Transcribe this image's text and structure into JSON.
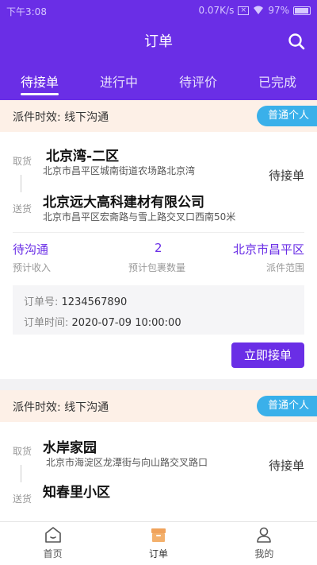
{
  "statusbar": {
    "time": "下午3:08",
    "network": "0.07K/s",
    "battery": "97%"
  },
  "header": {
    "title": "订单"
  },
  "tabs": [
    {
      "label": "待接单",
      "active": true
    },
    {
      "label": "进行中",
      "active": false
    },
    {
      "label": "待评价",
      "active": false
    },
    {
      "label": "已完成",
      "active": false
    }
  ],
  "orders": [
    {
      "dispatch_label": "派件时效: 线下沟通",
      "badge": "普通个人",
      "pickup_side": "取货",
      "deliver_side": "送货",
      "pickup_name": "北京湾-二区",
      "pickup_addr": "北京市昌平区城南街道农场路北京湾",
      "deliver_name": "北京远大高科建材有限公司",
      "deliver_addr": "北京市昌平区宏斋路与雪上路交叉口西南50米",
      "status": "待接单",
      "income_value": "待沟通",
      "income_label": "预计收入",
      "packages_value": "2",
      "packages_label": "预计包裹数量",
      "area_value": "北京市昌平区",
      "area_label": "派件范围",
      "order_no_label": "订单号:",
      "order_no": "1234567890",
      "order_time_label": "订单时间:",
      "order_time": "2020-07-09 10:00:00",
      "accept_label": "立即接单"
    },
    {
      "dispatch_label": "派件时效: 线下沟通",
      "badge": "普通个人",
      "pickup_side": "取货",
      "deliver_side": "送货",
      "pickup_name": "水岸家园",
      "pickup_addr": "北京市海淀区龙潭街与向山路交叉路口",
      "deliver_name": "知春里小区",
      "status": "待接单"
    }
  ],
  "bottomnav": [
    {
      "label": "首页",
      "icon": "home-icon"
    },
    {
      "label": "订单",
      "icon": "order-box-icon",
      "active": true
    },
    {
      "label": "我的",
      "icon": "user-icon"
    }
  ],
  "colors": {
    "primary": "#6a2ee6",
    "badge": "#3ab0ea",
    "dispatch_bg": "#fdf0e7"
  }
}
